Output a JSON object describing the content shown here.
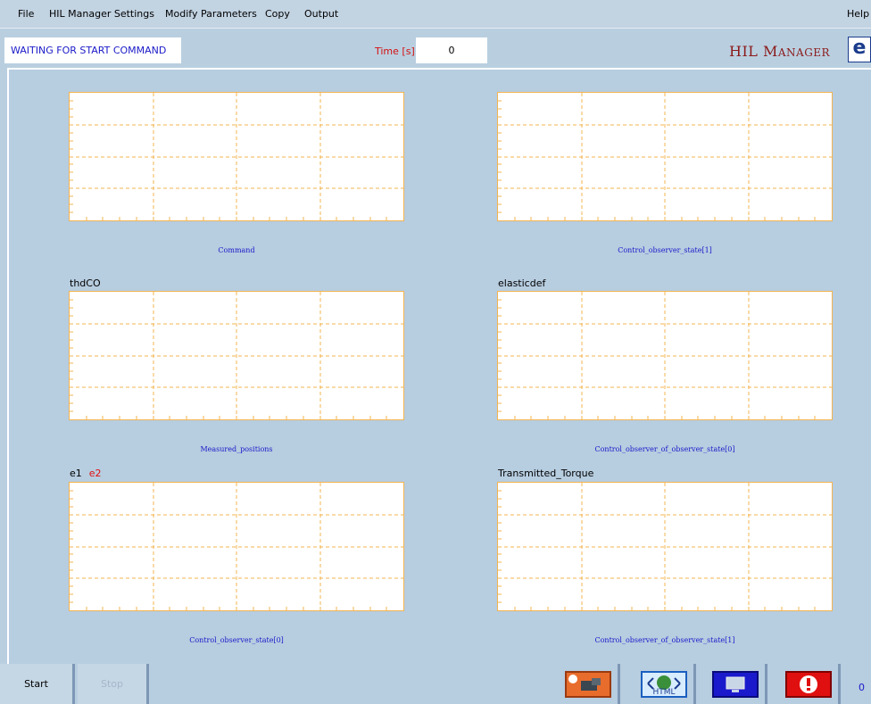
{
  "menu": {
    "items": [
      "File",
      "HIL Manager Settings",
      "Modify Parameters",
      "Copy",
      "Output"
    ],
    "help": "Help"
  },
  "status": {
    "message": "WAITING FOR START COMMAND",
    "time_label": "Time [s]:",
    "time_value": "0"
  },
  "logo": {
    "text_big_h": "HIL M",
    "text_small": "ANAGER",
    "icon_glyph": "e"
  },
  "plots": [
    {
      "title": "",
      "title2": "",
      "caption": "Command"
    },
    {
      "title": "",
      "title2": "",
      "caption": "Control_observer_state[1]"
    },
    {
      "title": "thdCO",
      "title2": "",
      "caption": "Measured_positions"
    },
    {
      "title": "elasticdef",
      "title2": "",
      "caption": "Control_observer_of_observer_state[0]"
    },
    {
      "title": "e1",
      "title2": "e2",
      "caption": "Control_observer_state[0]"
    },
    {
      "title": "Transmitted_Torque",
      "title2": "",
      "caption": "Control_observer_of_observer_state[1]"
    }
  ],
  "controls": {
    "start": "Start",
    "stop": "Stop",
    "counter": "0",
    "tools": [
      {
        "icon": "camera-snapshot-icon",
        "color": "#e86c2c"
      },
      {
        "icon": "html-export-icon",
        "color": "#6aa8ff"
      },
      {
        "icon": "monitor-icon",
        "color": "#1a1acc"
      },
      {
        "icon": "alert-stop-icon",
        "color": "#e01010"
      }
    ]
  },
  "colors": {
    "accent": "#1a1ac8",
    "alert": "#d41010",
    "plot_border": "#f3b451"
  }
}
